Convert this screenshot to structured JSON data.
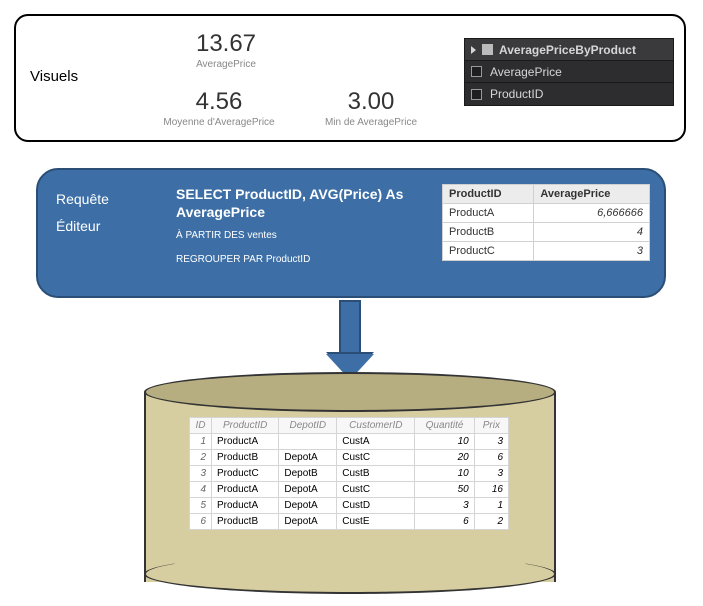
{
  "visuals": {
    "label": "Visuels",
    "kpi1": {
      "value": "13.67",
      "caption": "AveragePrice"
    },
    "kpi2": {
      "value": "4.56",
      "caption": "Moyenne d'AveragePrice"
    },
    "kpi3": {
      "value": "3.00",
      "caption": "Min de AveragePrice"
    }
  },
  "fields": {
    "table": "AveragePriceByProduct",
    "f1": "AveragePrice",
    "f2": "ProductID"
  },
  "query": {
    "label1": "Requête",
    "label2": "Éditeur",
    "sql1": "SELECT ProductID, AVG(Price) As AveragePrice",
    "sql2": "À PARTIR DES ventes",
    "sql3": "REGROUPER PAR ProductID"
  },
  "chart_data": {
    "type": "table",
    "title": "Query result",
    "columns": [
      "ProductID",
      "AveragePrice"
    ],
    "rows": [
      [
        "ProductA",
        "6,666666"
      ],
      [
        "ProductB",
        "4"
      ],
      [
        "ProductC",
        "3"
      ]
    ]
  },
  "source": {
    "columns": {
      "c0": "ID",
      "c1": "ProductID",
      "c2": "DepotID",
      "c3": "CustomerID",
      "c4": "Quantité",
      "c5": "Prix"
    },
    "rows": [
      {
        "id": "1",
        "p": "ProductA",
        "d": "",
        "cu": "CustA",
        "q": "10",
        "pr": "3"
      },
      {
        "id": "2",
        "p": "ProductB",
        "d": "DepotA",
        "cu": "CustC",
        "q": "20",
        "pr": "6"
      },
      {
        "id": "3",
        "p": "ProductC",
        "d": "DepotB",
        "cu": "CustB",
        "q": "10",
        "pr": "3"
      },
      {
        "id": "4",
        "p": "ProductA",
        "d": "DepotA",
        "cu": "CustC",
        "q": "50",
        "pr": "16"
      },
      {
        "id": "5",
        "p": "ProductA",
        "d": "DepotA",
        "cu": "CustD",
        "q": "3",
        "pr": "1"
      },
      {
        "id": "6",
        "p": "ProductB",
        "d": "DepotA",
        "cu": "CustE",
        "q": "6",
        "pr": "2"
      }
    ]
  }
}
